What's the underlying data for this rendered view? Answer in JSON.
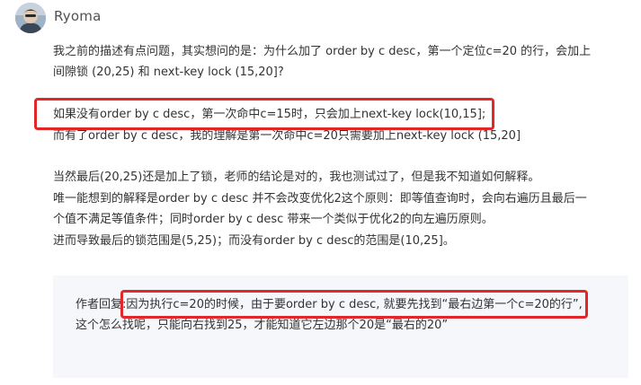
{
  "comment": {
    "username": "Ryoma",
    "lines": [
      "我之前的描述有点问题，其实想问的是：为什么加了 order by c desc，第一个定位c=20 的行，会加上",
      "间隙锁 (20,25) 和 next-key lock (15,20]?",
      "如果没有order by c desc，第一次命中c=15时，只会加上next-key lock(10,15];",
      "而有了order by c desc，我的理解是第一次命中c=20只需要加上next-key lock (15,20]",
      "当然最后(20,25)还是加上了锁，老师的结论是对的，我也测试过了，但是我不知道如何解释。",
      "唯一能想到的解释是order by c desc 并不会改变优化2这个原则：即等值查询时，会向右遍历且最后一",
      "个值不满足等值条件；同时order by c desc 带来一个类似于优化2的向左遍历原则。",
      "进而导致最后的锁范围是(5,25)；而没有order by c desc的范围是(10,25]。"
    ]
  },
  "reply": {
    "author_label": "作者回复:",
    "line1": "因为执行c=20的时候，由于要order by c desc, 就要先找到“最右边第一个c=20的行”,",
    "line2": "这个怎么找呢，只能向右找到25，才能知道它左边那个20是“最右的20”"
  },
  "colors": {
    "highlight_box": "#e3262a",
    "reply_background": "#f6f7fb",
    "text": "#333333"
  }
}
